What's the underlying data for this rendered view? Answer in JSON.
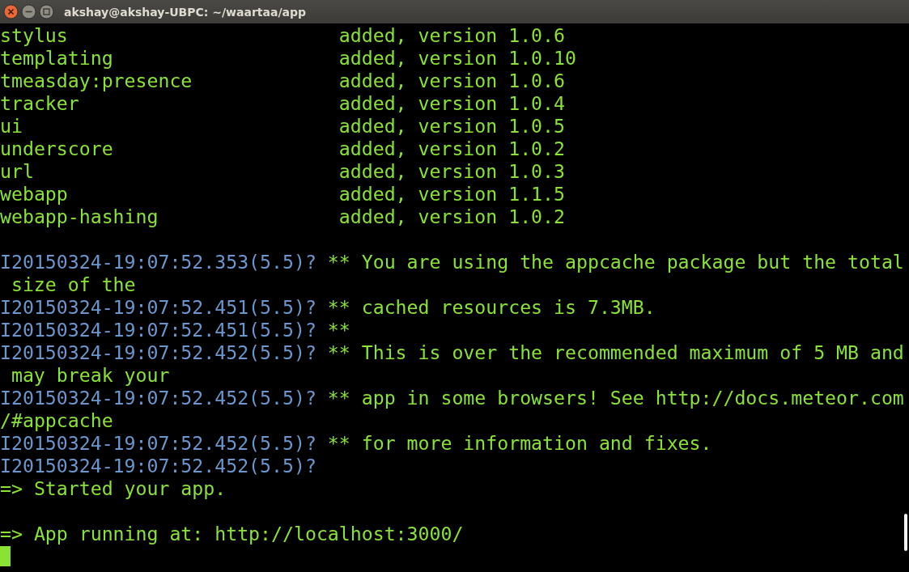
{
  "window": {
    "title": "akshay@akshay-UBPC: ~/waartaa/app"
  },
  "lines": [
    {
      "kind": "package",
      "name": "stylus",
      "status": "added, version 1.0.6"
    },
    {
      "kind": "package",
      "name": "templating",
      "status": "added, version 1.0.10"
    },
    {
      "kind": "package",
      "name": "tmeasday:presence",
      "status": "added, version 1.0.6"
    },
    {
      "kind": "package",
      "name": "tracker",
      "status": "added, version 1.0.4"
    },
    {
      "kind": "package",
      "name": "ui",
      "status": "added, version 1.0.5"
    },
    {
      "kind": "package",
      "name": "underscore",
      "status": "added, version 1.0.2"
    },
    {
      "kind": "package",
      "name": "url",
      "status": "added, version 1.0.3"
    },
    {
      "kind": "package",
      "name": "webapp",
      "status": "added, version 1.1.5"
    },
    {
      "kind": "package",
      "name": "webapp-hashing",
      "status": "added, version 1.0.2"
    },
    {
      "kind": "blank"
    },
    {
      "kind": "log",
      "prefix": "I20150324-19:07:52.353(5.5)?",
      "message": "** You are using the appcache package but the total"
    },
    {
      "kind": "wrap",
      "text": "size of the"
    },
    {
      "kind": "log",
      "prefix": "I20150324-19:07:52.451(5.5)?",
      "message": "** cached resources is 7.3MB."
    },
    {
      "kind": "log",
      "prefix": "I20150324-19:07:52.451(5.5)?",
      "message": "**"
    },
    {
      "kind": "log",
      "prefix": "I20150324-19:07:52.452(5.5)?",
      "message": "** This is over the recommended maximum of 5 MB and"
    },
    {
      "kind": "wrap",
      "text": "may break your"
    },
    {
      "kind": "log",
      "prefix": "I20150324-19:07:52.452(5.5)?",
      "message": "** app in some browsers! See http://docs.meteor.com"
    },
    {
      "kind": "text",
      "text": "/#appcache"
    },
    {
      "kind": "log",
      "prefix": "I20150324-19:07:52.452(5.5)?",
      "message": "** for more information and fixes."
    },
    {
      "kind": "log",
      "prefix": "I20150324-19:07:52.452(5.5)?"
    },
    {
      "kind": "text",
      "text": "=> Started your app."
    },
    {
      "kind": "blank"
    },
    {
      "kind": "text",
      "text": "=> App running at: http://localhost:3000/"
    },
    {
      "kind": "cursor"
    }
  ]
}
